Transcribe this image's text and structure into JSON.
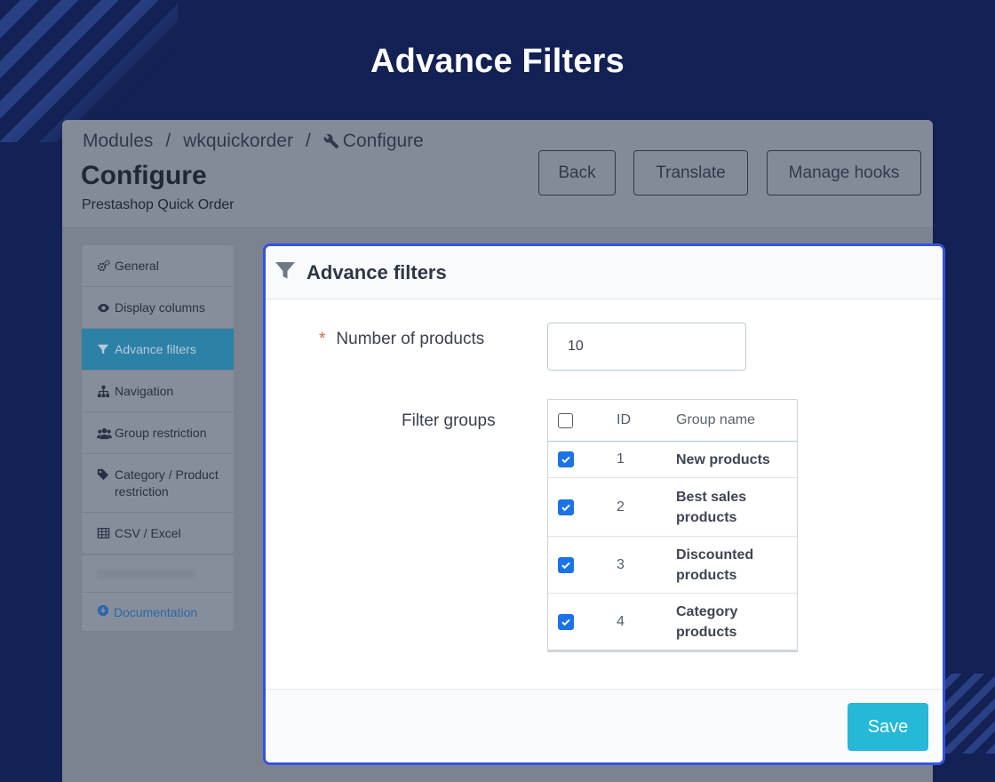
{
  "hero_title": "Advance Filters",
  "breadcrumb": {
    "items": [
      "Modules",
      "wkquickorder",
      "Configure"
    ],
    "separator": "/"
  },
  "page": {
    "title": "Configure",
    "subtitle": "Prestashop Quick Order"
  },
  "header_buttons": {
    "back": "Back",
    "translate": "Translate",
    "manage_hooks": "Manage hooks"
  },
  "sidebar": {
    "items": [
      {
        "label": "General",
        "icon": "gears-icon",
        "active": false
      },
      {
        "label": "Display columns",
        "icon": "eye-icon",
        "active": false
      },
      {
        "label": "Advance filters",
        "icon": "filter-icon",
        "active": true
      },
      {
        "label": "Navigation",
        "icon": "sitemap-icon",
        "active": false
      },
      {
        "label": "Group restriction",
        "icon": "users-icon",
        "active": false
      },
      {
        "label": "Category / Product restriction",
        "icon": "tag-icon",
        "active": false
      },
      {
        "label": "CSV / Excel",
        "icon": "table-icon",
        "active": false
      }
    ],
    "documentation": "Documentation"
  },
  "panel": {
    "title": "Advance filters",
    "number_of_products": {
      "label": "Number of products",
      "required_mark": "*",
      "value": "10"
    },
    "filter_groups": {
      "label": "Filter groups",
      "columns": {
        "id": "ID",
        "name": "Group name"
      },
      "rows": [
        {
          "id": "1",
          "name": "New products",
          "checked": true
        },
        {
          "id": "2",
          "name": "Best sales products",
          "checked": true
        },
        {
          "id": "3",
          "name": "Discounted products",
          "checked": true
        },
        {
          "id": "4",
          "name": "Category products",
          "checked": true
        }
      ]
    },
    "save_label": "Save"
  },
  "colors": {
    "accent": "#25b9d7",
    "active_sidebar": "#2b81a6",
    "background": "#132155",
    "highlight_border": "#3553e0"
  }
}
